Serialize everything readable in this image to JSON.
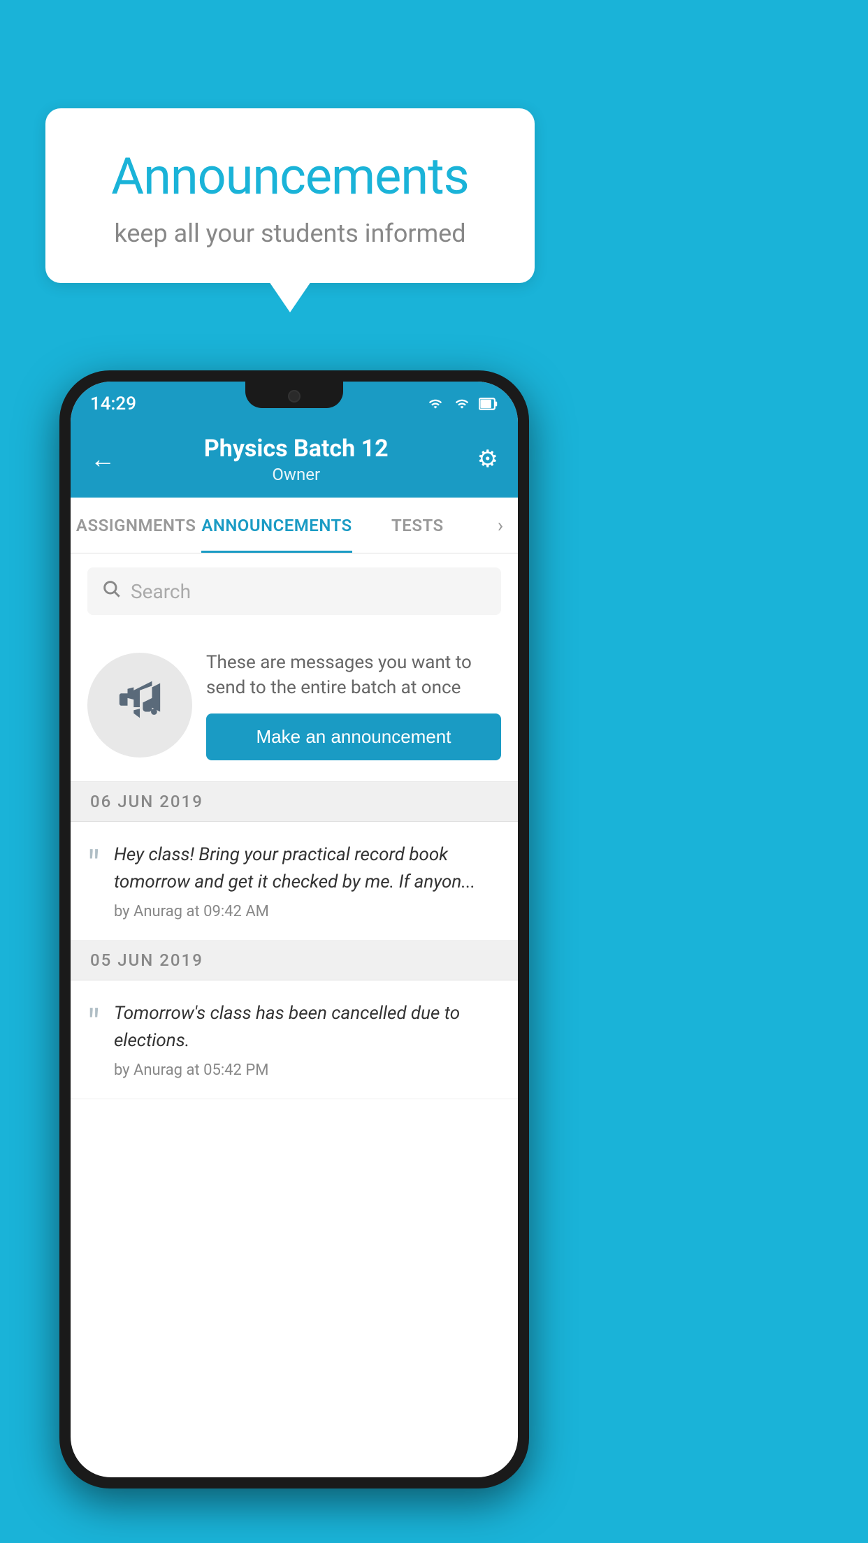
{
  "background_color": "#1ab3d8",
  "speech_bubble": {
    "title": "Announcements",
    "subtitle": "keep all your students informed"
  },
  "phone": {
    "status_bar": {
      "time": "14:29"
    },
    "header": {
      "back_label": "←",
      "title": "Physics Batch 12",
      "subtitle": "Owner",
      "settings_icon": "⚙"
    },
    "tabs": [
      {
        "label": "ASSIGNMENTS",
        "active": false
      },
      {
        "label": "ANNOUNCEMENTS",
        "active": true
      },
      {
        "label": "TESTS",
        "active": false
      }
    ],
    "search": {
      "placeholder": "Search"
    },
    "announcement_prompt": {
      "description_text": "These are messages you want to send to the entire batch at once",
      "button_label": "Make an announcement"
    },
    "date_groups": [
      {
        "date": "06  JUN  2019",
        "items": [
          {
            "text": "Hey class! Bring your practical record book tomorrow and get it checked by me. If anyon...",
            "meta": "by Anurag at 09:42 AM"
          }
        ]
      },
      {
        "date": "05  JUN  2019",
        "items": [
          {
            "text": "Tomorrow's class has been cancelled due to elections.",
            "meta": "by Anurag at 05:42 PM"
          }
        ]
      }
    ]
  }
}
